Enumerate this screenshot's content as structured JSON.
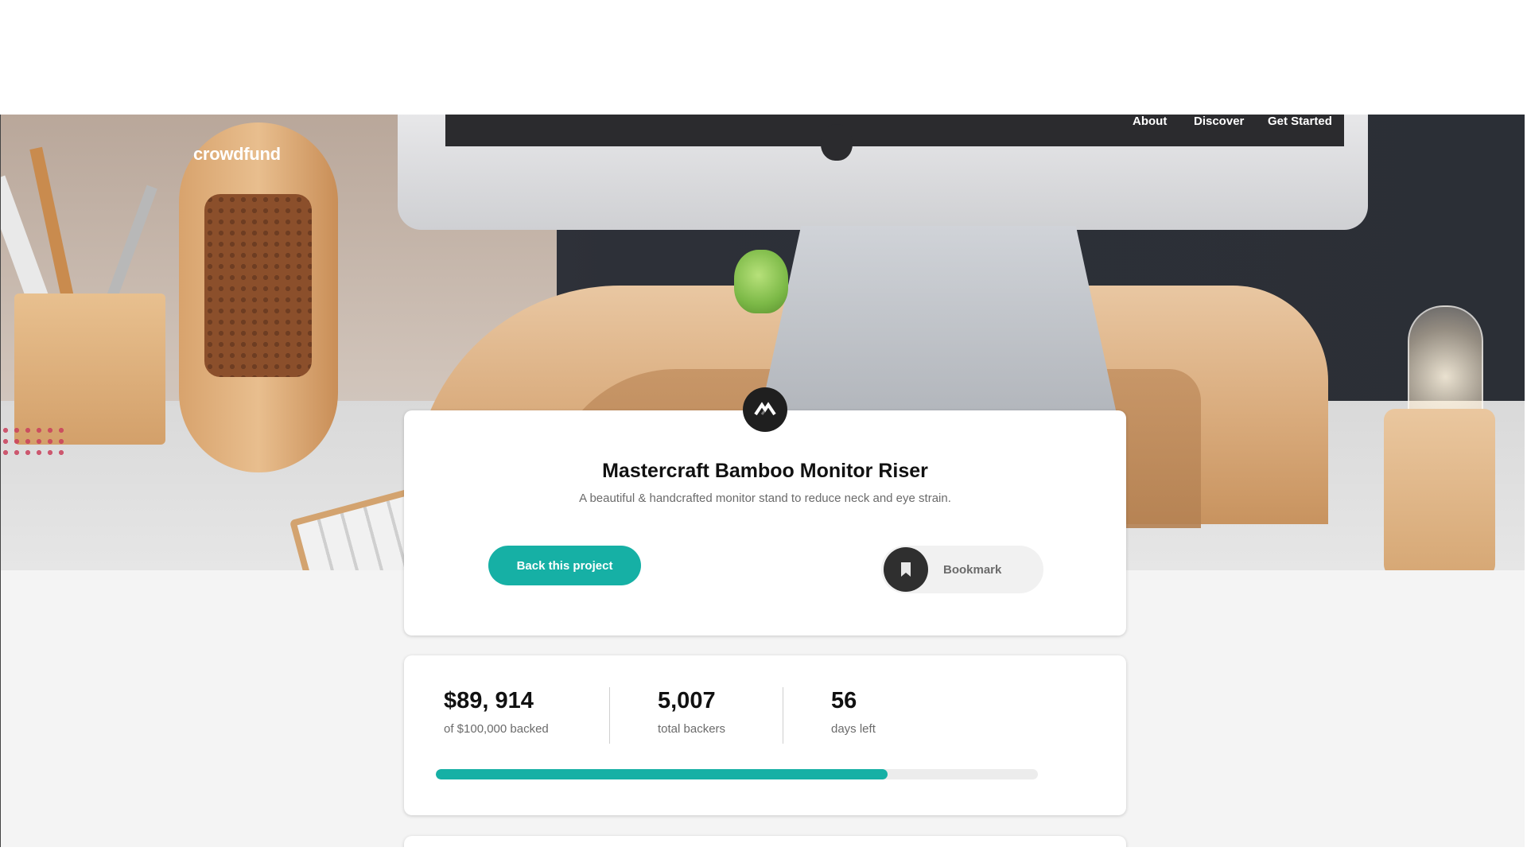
{
  "header": {
    "logo": "crowdfund",
    "nav": [
      "About",
      "Discover",
      "Get Started"
    ]
  },
  "hero": {
    "image": "desk-setup-photo"
  },
  "project": {
    "badge_icon": "mastercraft-logo-icon",
    "title": "Mastercraft Bamboo Monitor Riser",
    "description": "A beautiful & handcrafted monitor stand to reduce neck and eye strain.",
    "back_button": "Back this project",
    "bookmark_label": "Bookmark",
    "bookmark_icon": "bookmark-icon"
  },
  "stats": {
    "backed_amount": "$89, 914",
    "backed_label": "of $100,000 backed",
    "backers": "5,007",
    "backers_label": "total backers",
    "days": "56",
    "days_label": "days left",
    "progress_fraction": 0.75
  },
  "colors": {
    "accent": "#16b0a5",
    "dark": "#1f1f1f",
    "background": "#f4f4f4"
  }
}
